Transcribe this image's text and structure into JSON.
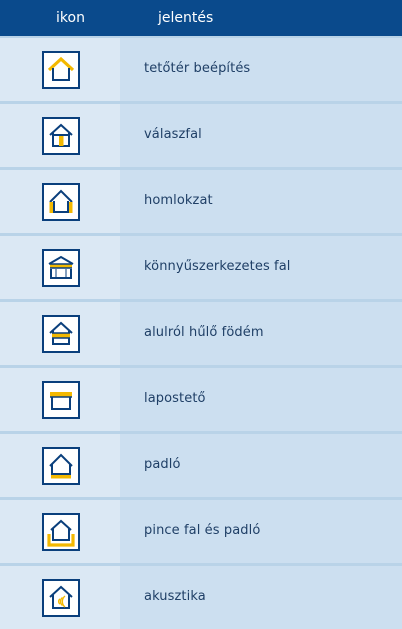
{
  "header": {
    "icon_col": "ikon",
    "meaning_col": "jelentés"
  },
  "colors": {
    "header_bg": "#0a4a8c",
    "icon_border": "#0a3f7c",
    "accent_yellow": "#f3b800",
    "row_bg": "#ccdff0"
  },
  "rows": [
    {
      "label": "tetőtér beépítés",
      "icon": "attic-insulation-icon"
    },
    {
      "label": "válaszfal",
      "icon": "partition-wall-icon"
    },
    {
      "label": "homlokzat",
      "icon": "facade-icon"
    },
    {
      "label": "könnyűszerkezetes fal",
      "icon": "lightweight-wall-icon"
    },
    {
      "label": "alulról hűlő födém",
      "icon": "floor-slab-cooled-from-below-icon"
    },
    {
      "label": "lapostető",
      "icon": "flat-roof-icon"
    },
    {
      "label": "padló",
      "icon": "floor-icon"
    },
    {
      "label": "pince fal és padló",
      "icon": "basement-wall-and-floor-icon"
    },
    {
      "label": "akusztika",
      "icon": "acoustics-icon"
    }
  ]
}
